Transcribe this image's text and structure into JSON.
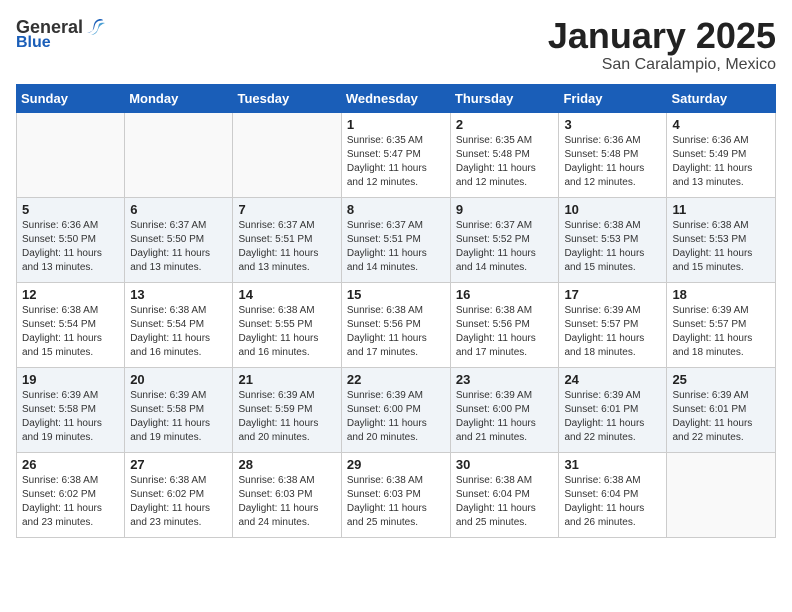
{
  "header": {
    "logo_general": "General",
    "logo_blue": "Blue",
    "month": "January 2025",
    "location": "San Caralampio, Mexico"
  },
  "weekdays": [
    "Sunday",
    "Monday",
    "Tuesday",
    "Wednesday",
    "Thursday",
    "Friday",
    "Saturday"
  ],
  "weeks": [
    [
      {
        "day": "",
        "info": ""
      },
      {
        "day": "",
        "info": ""
      },
      {
        "day": "",
        "info": ""
      },
      {
        "day": "1",
        "info": "Sunrise: 6:35 AM\nSunset: 5:47 PM\nDaylight: 11 hours\nand 12 minutes."
      },
      {
        "day": "2",
        "info": "Sunrise: 6:35 AM\nSunset: 5:48 PM\nDaylight: 11 hours\nand 12 minutes."
      },
      {
        "day": "3",
        "info": "Sunrise: 6:36 AM\nSunset: 5:48 PM\nDaylight: 11 hours\nand 12 minutes."
      },
      {
        "day": "4",
        "info": "Sunrise: 6:36 AM\nSunset: 5:49 PM\nDaylight: 11 hours\nand 13 minutes."
      }
    ],
    [
      {
        "day": "5",
        "info": "Sunrise: 6:36 AM\nSunset: 5:50 PM\nDaylight: 11 hours\nand 13 minutes."
      },
      {
        "day": "6",
        "info": "Sunrise: 6:37 AM\nSunset: 5:50 PM\nDaylight: 11 hours\nand 13 minutes."
      },
      {
        "day": "7",
        "info": "Sunrise: 6:37 AM\nSunset: 5:51 PM\nDaylight: 11 hours\nand 13 minutes."
      },
      {
        "day": "8",
        "info": "Sunrise: 6:37 AM\nSunset: 5:51 PM\nDaylight: 11 hours\nand 14 minutes."
      },
      {
        "day": "9",
        "info": "Sunrise: 6:37 AM\nSunset: 5:52 PM\nDaylight: 11 hours\nand 14 minutes."
      },
      {
        "day": "10",
        "info": "Sunrise: 6:38 AM\nSunset: 5:53 PM\nDaylight: 11 hours\nand 15 minutes."
      },
      {
        "day": "11",
        "info": "Sunrise: 6:38 AM\nSunset: 5:53 PM\nDaylight: 11 hours\nand 15 minutes."
      }
    ],
    [
      {
        "day": "12",
        "info": "Sunrise: 6:38 AM\nSunset: 5:54 PM\nDaylight: 11 hours\nand 15 minutes."
      },
      {
        "day": "13",
        "info": "Sunrise: 6:38 AM\nSunset: 5:54 PM\nDaylight: 11 hours\nand 16 minutes."
      },
      {
        "day": "14",
        "info": "Sunrise: 6:38 AM\nSunset: 5:55 PM\nDaylight: 11 hours\nand 16 minutes."
      },
      {
        "day": "15",
        "info": "Sunrise: 6:38 AM\nSunset: 5:56 PM\nDaylight: 11 hours\nand 17 minutes."
      },
      {
        "day": "16",
        "info": "Sunrise: 6:38 AM\nSunset: 5:56 PM\nDaylight: 11 hours\nand 17 minutes."
      },
      {
        "day": "17",
        "info": "Sunrise: 6:39 AM\nSunset: 5:57 PM\nDaylight: 11 hours\nand 18 minutes."
      },
      {
        "day": "18",
        "info": "Sunrise: 6:39 AM\nSunset: 5:57 PM\nDaylight: 11 hours\nand 18 minutes."
      }
    ],
    [
      {
        "day": "19",
        "info": "Sunrise: 6:39 AM\nSunset: 5:58 PM\nDaylight: 11 hours\nand 19 minutes."
      },
      {
        "day": "20",
        "info": "Sunrise: 6:39 AM\nSunset: 5:58 PM\nDaylight: 11 hours\nand 19 minutes."
      },
      {
        "day": "21",
        "info": "Sunrise: 6:39 AM\nSunset: 5:59 PM\nDaylight: 11 hours\nand 20 minutes."
      },
      {
        "day": "22",
        "info": "Sunrise: 6:39 AM\nSunset: 6:00 PM\nDaylight: 11 hours\nand 20 minutes."
      },
      {
        "day": "23",
        "info": "Sunrise: 6:39 AM\nSunset: 6:00 PM\nDaylight: 11 hours\nand 21 minutes."
      },
      {
        "day": "24",
        "info": "Sunrise: 6:39 AM\nSunset: 6:01 PM\nDaylight: 11 hours\nand 22 minutes."
      },
      {
        "day": "25",
        "info": "Sunrise: 6:39 AM\nSunset: 6:01 PM\nDaylight: 11 hours\nand 22 minutes."
      }
    ],
    [
      {
        "day": "26",
        "info": "Sunrise: 6:38 AM\nSunset: 6:02 PM\nDaylight: 11 hours\nand 23 minutes."
      },
      {
        "day": "27",
        "info": "Sunrise: 6:38 AM\nSunset: 6:02 PM\nDaylight: 11 hours\nand 23 minutes."
      },
      {
        "day": "28",
        "info": "Sunrise: 6:38 AM\nSunset: 6:03 PM\nDaylight: 11 hours\nand 24 minutes."
      },
      {
        "day": "29",
        "info": "Sunrise: 6:38 AM\nSunset: 6:03 PM\nDaylight: 11 hours\nand 25 minutes."
      },
      {
        "day": "30",
        "info": "Sunrise: 6:38 AM\nSunset: 6:04 PM\nDaylight: 11 hours\nand 25 minutes."
      },
      {
        "day": "31",
        "info": "Sunrise: 6:38 AM\nSunset: 6:04 PM\nDaylight: 11 hours\nand 26 minutes."
      },
      {
        "day": "",
        "info": ""
      }
    ]
  ]
}
